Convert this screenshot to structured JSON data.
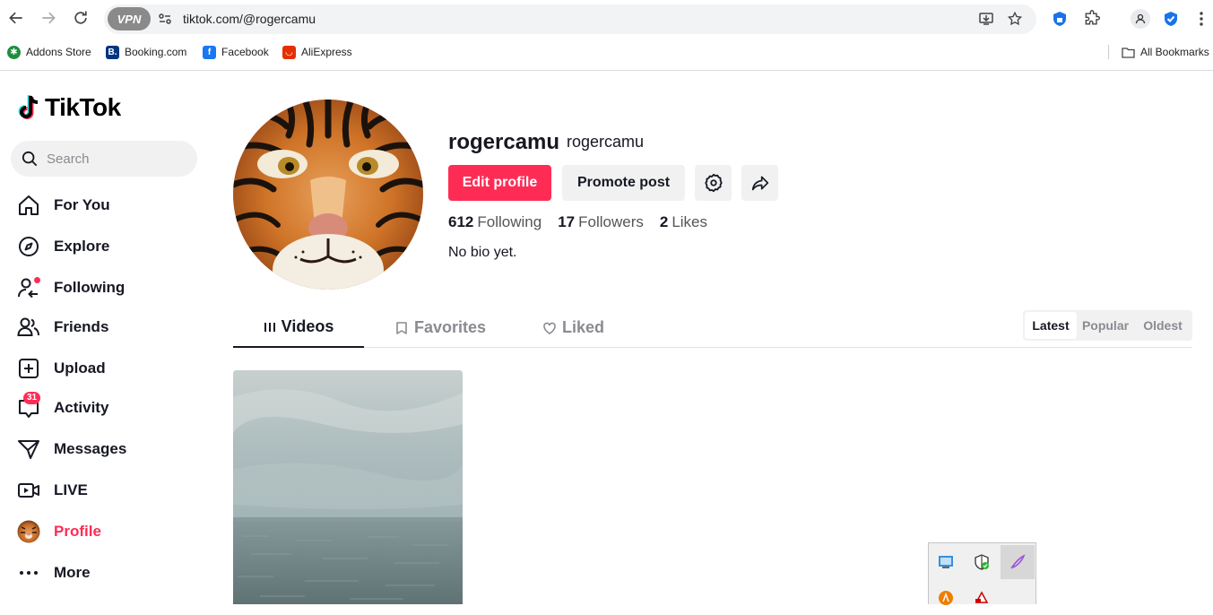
{
  "browser": {
    "vpn_label": "VPN",
    "url": "tiktok.com/@rogercamu",
    "bookmarks": [
      {
        "label": "Addons Store",
        "icon": "addons-store-icon",
        "color": "#1e8e3e"
      },
      {
        "label": "Booking.com",
        "icon": "booking-icon",
        "color": "#003580"
      },
      {
        "label": "Facebook",
        "icon": "facebook-icon",
        "color": "#1877f2"
      },
      {
        "label": "AliExpress",
        "icon": "aliexpress-icon",
        "color": "#e62e04"
      }
    ],
    "all_bookmarks_label": "All Bookmarks"
  },
  "sidebar": {
    "logo_text": "TikTok",
    "search_placeholder": "Search",
    "items": [
      {
        "label": "For You",
        "icon": "home-icon"
      },
      {
        "label": "Explore",
        "icon": "compass-icon"
      },
      {
        "label": "Following",
        "icon": "following-icon",
        "dot": true
      },
      {
        "label": "Friends",
        "icon": "friends-icon"
      },
      {
        "label": "Upload",
        "icon": "upload-icon"
      },
      {
        "label": "Activity",
        "icon": "activity-icon",
        "badge": "31"
      },
      {
        "label": "Messages",
        "icon": "messages-icon"
      },
      {
        "label": "LIVE",
        "icon": "live-icon"
      },
      {
        "label": "Profile",
        "icon": "profile-avatar",
        "active": true
      },
      {
        "label": "More",
        "icon": "more-icon"
      }
    ]
  },
  "profile": {
    "username": "rogercamu",
    "nickname": "rogercamu",
    "edit_label": "Edit profile",
    "promote_label": "Promote post",
    "stats": {
      "following_count": "612",
      "following_label": "Following",
      "followers_count": "17",
      "followers_label": "Followers",
      "likes_count": "2",
      "likes_label": "Likes"
    },
    "bio": "No bio yet."
  },
  "tabs": [
    {
      "label": "Videos",
      "icon": "grid-icon",
      "active": true
    },
    {
      "label": "Favorites",
      "icon": "bookmark-icon"
    },
    {
      "label": "Liked",
      "icon": "heart-icon"
    }
  ],
  "sort": {
    "options": [
      "Latest",
      "Popular",
      "Oldest"
    ],
    "selected": "Latest"
  },
  "colors": {
    "accent": "#fe2c55",
    "text": "#161823",
    "muted": "#8a8b91"
  }
}
